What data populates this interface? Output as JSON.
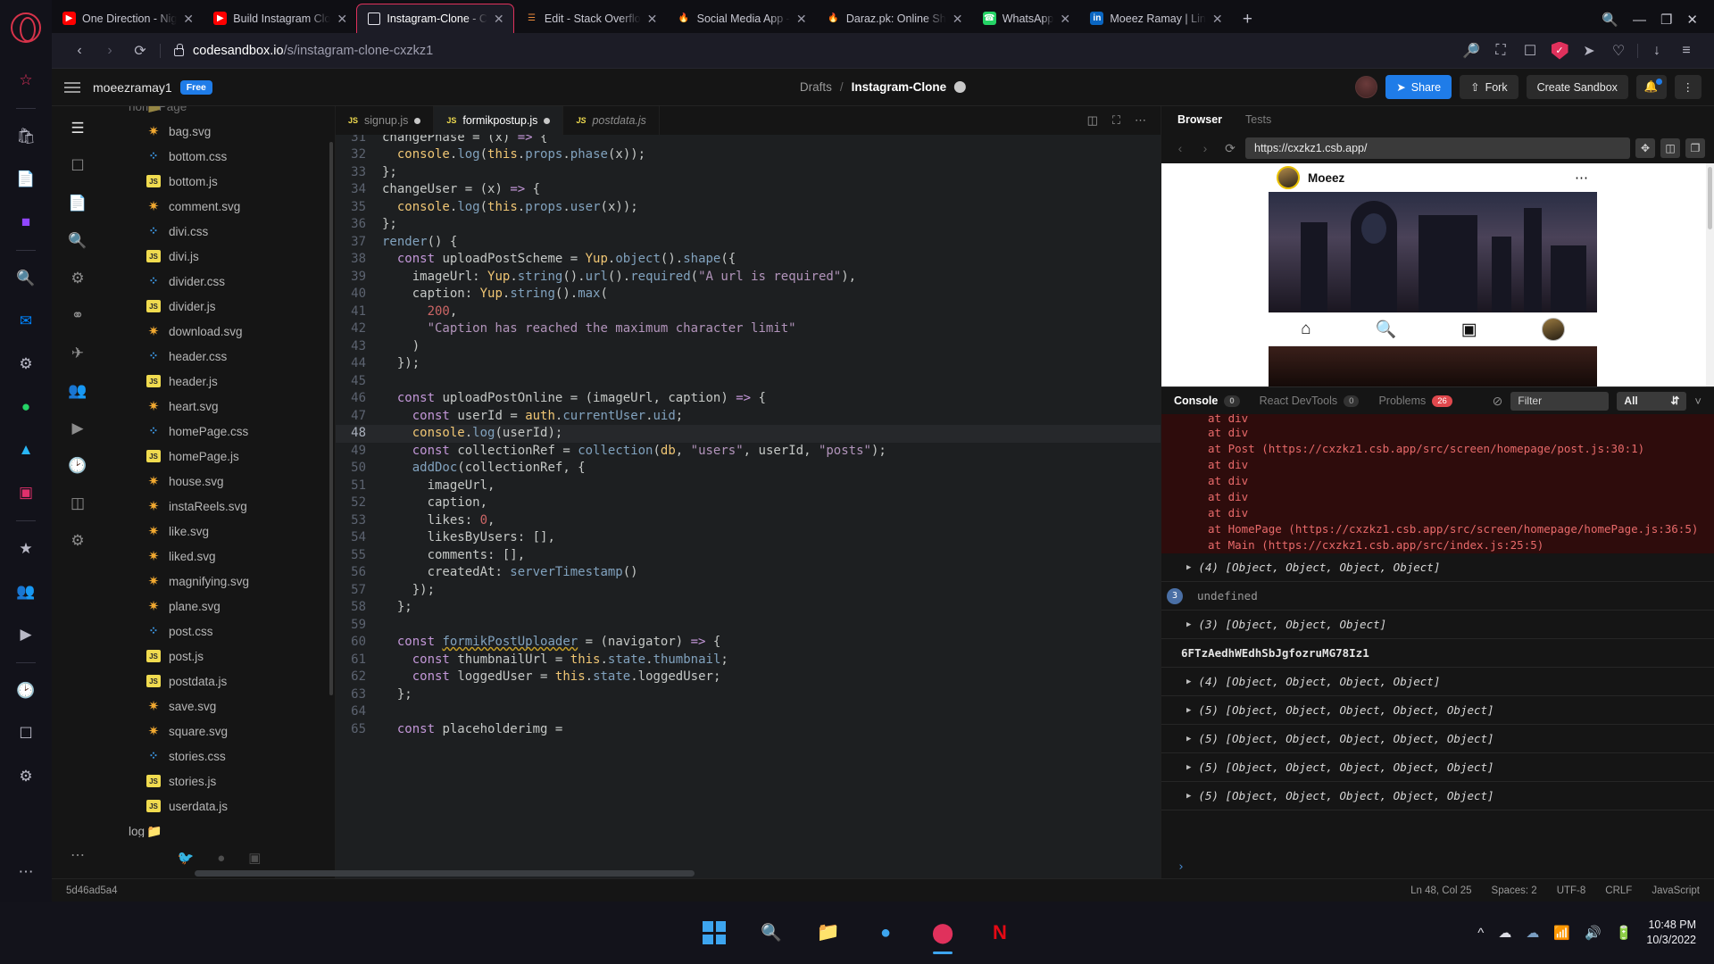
{
  "browser": {
    "sidebar_icons": [
      "opera-logo",
      "gamepad-icon",
      "extension-icon",
      "file-icon",
      "twitch-icon",
      "minus-icon",
      "messenger-icon",
      "gear-icon",
      "whatsapp-icon",
      "instagram-icon",
      "minus-icon-2",
      "people-icon"
    ],
    "tabs": [
      {
        "title": "One Direction - Nig",
        "favicon": "youtube-icon",
        "active": false
      },
      {
        "title": "Build Instagram Clo",
        "favicon": "youtube-icon",
        "active": false
      },
      {
        "title": "Instagram-Clone - C",
        "favicon": "codesandbox-icon",
        "active": true
      },
      {
        "title": "Edit - Stack Overflo",
        "favicon": "stackoverflow-icon",
        "active": false
      },
      {
        "title": "Social Media App -",
        "favicon": "firebase-icon",
        "active": false
      },
      {
        "title": "Daraz.pk: Online Sh",
        "favicon": "daraz-icon",
        "active": false
      },
      {
        "title": "WhatsApp",
        "favicon": "whatsapp-icon",
        "active": false
      },
      {
        "title": "Moeez Ramay | Lin",
        "favicon": "linkedin-icon",
        "active": false
      }
    ],
    "new_tab_label": "+",
    "window_controls": {
      "minimize": "—",
      "maximize": "❐",
      "close": "✕"
    },
    "nav": {
      "back": "‹",
      "forward": "›",
      "reload": "⟳",
      "url_domain": "codesandbox.io",
      "url_path": "/s/instagram-clone-cxzkz1",
      "url_full": "codesandbox.io/s/instagram-clone-cxzkz1",
      "right_icons": [
        "zoom-out-icon",
        "snapshot-icon",
        "camera-icon",
        "vpn-shield-icon",
        "send-icon",
        "heart-icon",
        "download-icon",
        "sliders-icon"
      ]
    }
  },
  "csb": {
    "header": {
      "username": "moeezramay1",
      "plan_badge": "Free",
      "breadcrumb_drafts": "Drafts",
      "breadcrumb_separator": "/",
      "sandbox_name": "Instagram-Clone",
      "share_label": "Share",
      "fork_label": "Fork",
      "create_sandbox_label": "Create Sandbox",
      "notifications_icon": "bell-icon",
      "more_icon": "kebab-menu-icon"
    },
    "rail_icons": [
      "files-icon",
      "search-icon",
      "git-icon",
      "deploy-icon",
      "dependencies-icon",
      "settings-icon",
      "clock-icon",
      "box-icon",
      "gear2-icon",
      "more-icon"
    ],
    "explorer": {
      "files": [
        {
          "name": "homePage",
          "type": "folder-partial"
        },
        {
          "name": "bag.svg",
          "type": "svg"
        },
        {
          "name": "bottom.css",
          "type": "css"
        },
        {
          "name": "bottom.js",
          "type": "js"
        },
        {
          "name": "comment.svg",
          "type": "svg"
        },
        {
          "name": "divi.css",
          "type": "css"
        },
        {
          "name": "divi.js",
          "type": "js"
        },
        {
          "name": "divider.css",
          "type": "css"
        },
        {
          "name": "divider.js",
          "type": "js"
        },
        {
          "name": "download.svg",
          "type": "svg"
        },
        {
          "name": "header.css",
          "type": "css"
        },
        {
          "name": "header.js",
          "type": "js"
        },
        {
          "name": "heart.svg",
          "type": "svg"
        },
        {
          "name": "homePage.css",
          "type": "css"
        },
        {
          "name": "homePage.js",
          "type": "js"
        },
        {
          "name": "house.svg",
          "type": "svg"
        },
        {
          "name": "instaReels.svg",
          "type": "svg"
        },
        {
          "name": "like.svg",
          "type": "svg"
        },
        {
          "name": "liked.svg",
          "type": "svg"
        },
        {
          "name": "magnifying.svg",
          "type": "svg"
        },
        {
          "name": "plane.svg",
          "type": "svg"
        },
        {
          "name": "post.css",
          "type": "css"
        },
        {
          "name": "post.js",
          "type": "js"
        },
        {
          "name": "postdata.js",
          "type": "js"
        },
        {
          "name": "save.svg",
          "type": "svg"
        },
        {
          "name": "square.svg",
          "type": "svg"
        },
        {
          "name": "stories.css",
          "type": "css"
        },
        {
          "name": "stories.js",
          "type": "js"
        },
        {
          "name": "userdata.js",
          "type": "js"
        },
        {
          "name": "log",
          "type": "folder"
        }
      ],
      "footer_icons": [
        "twitter-icon",
        "github-icon",
        "instagram-icon"
      ]
    },
    "editor": {
      "tabs": [
        {
          "label": "signup.js",
          "active": false,
          "dirty": true,
          "italic": false
        },
        {
          "label": "formikpostup.js",
          "active": true,
          "dirty": true,
          "italic": false
        },
        {
          "label": "postdata.js",
          "active": false,
          "dirty": false,
          "italic": true
        }
      ],
      "tab_actions": [
        "split-editor-icon",
        "preview-icon",
        "more-icon"
      ],
      "lines": [
        {
          "n": 31,
          "text": "changePhase = (x) => {",
          "clipped": true
        },
        {
          "n": 32,
          "text": "  console.log(this.props.phase(x));"
        },
        {
          "n": 33,
          "text": "};"
        },
        {
          "n": 34,
          "text": "changeUser = (x) => {"
        },
        {
          "n": 35,
          "text": "  console.log(this.props.user(x));"
        },
        {
          "n": 36,
          "text": "};"
        },
        {
          "n": 37,
          "text": "render() {"
        },
        {
          "n": 38,
          "text": "  const uploadPostScheme = Yup.object().shape({"
        },
        {
          "n": 39,
          "text": "    imageUrl: Yup.string().url().required(\"A url is required\"),"
        },
        {
          "n": 40,
          "text": "    caption: Yup.string().max("
        },
        {
          "n": 41,
          "text": "      200,"
        },
        {
          "n": 42,
          "text": "      \"Caption has reached the maximum character limit\""
        },
        {
          "n": 43,
          "text": "    )"
        },
        {
          "n": 44,
          "text": "  });"
        },
        {
          "n": 45,
          "text": ""
        },
        {
          "n": 46,
          "text": "  const uploadPostOnline = (imageUrl, caption) => {"
        },
        {
          "n": 47,
          "text": "    const userId = auth.currentUser.uid;"
        },
        {
          "n": 48,
          "text": "    console.log(userId);",
          "highlight": true
        },
        {
          "n": 49,
          "text": "    const collectionRef = collection(db, \"users\", userId, \"posts\");"
        },
        {
          "n": 50,
          "text": "    addDoc(collectionRef, {"
        },
        {
          "n": 51,
          "text": "      imageUrl,"
        },
        {
          "n": 52,
          "text": "      caption,"
        },
        {
          "n": 53,
          "text": "      likes: 0,"
        },
        {
          "n": 54,
          "text": "      likesByUsers: [],"
        },
        {
          "n": 55,
          "text": "      comments: [],"
        },
        {
          "n": 56,
          "text": "      createdAt: serverTimestamp()"
        },
        {
          "n": 57,
          "text": "    });"
        },
        {
          "n": 58,
          "text": "  };"
        },
        {
          "n": 59,
          "text": ""
        },
        {
          "n": 60,
          "text": "  const formikPostUploader = (navigator) => {"
        },
        {
          "n": 61,
          "text": "    const thumbnailUrl = this.state.thumbnail;"
        },
        {
          "n": 62,
          "text": "    const loggedUser = this.state.loggedUser;"
        },
        {
          "n": 63,
          "text": "  };"
        },
        {
          "n": 64,
          "text": ""
        },
        {
          "n": 65,
          "text": "  const placeholderimg ="
        }
      ]
    },
    "preview": {
      "tabs": [
        {
          "label": "Browser",
          "active": true
        },
        {
          "label": "Tests",
          "active": false
        }
      ],
      "url": "https://cxzkz1.csb.app/",
      "nav_icons": [
        "back-icon",
        "forward-icon",
        "reload-icon"
      ],
      "action_icons": [
        "responsive-icon",
        "split-icon",
        "popout-icon"
      ],
      "app": {
        "username": "Moeez",
        "menu_icon": "more-dots-icon",
        "nav_icons": [
          "home-icon",
          "search-icon",
          "reels-icon",
          "profile-avatar"
        ]
      }
    },
    "console": {
      "tabs": [
        {
          "label": "Console",
          "badge": "0",
          "active": true,
          "error": false
        },
        {
          "label": "React DevTools",
          "badge": "0",
          "active": false,
          "error": false
        },
        {
          "label": "Problems",
          "badge": "26",
          "active": false,
          "error": true
        }
      ],
      "clear_icon": "clear-console-icon",
      "filter_placeholder": "Filter",
      "level_selected": "All",
      "collapse_icon": "chevron-down-icon",
      "error_stack": [
        "at div",
        "at div",
        "at Post (https://cxzkz1.csb.app/src/screen/homepage/post.js:30:1)",
        "at div",
        "at div",
        "at div",
        "at div",
        "at HomePage (https://cxzkz1.csb.app/src/screen/homepage/homePage.js:36:5)",
        "at Main (https://cxzkz1.csb.app/src/index.js:25:5)"
      ],
      "rows": [
        {
          "kind": "array",
          "text": "(4) [Object, Object, Object, Object]"
        },
        {
          "kind": "undefined",
          "text": "undefined",
          "count": "3"
        },
        {
          "kind": "array",
          "text": "(3) [Object, Object, Object]"
        },
        {
          "kind": "string",
          "text": "6FTzAedhWEdhSbJgfozruMG78Iz1"
        },
        {
          "kind": "array",
          "text": "(4) [Object, Object, Object, Object]"
        },
        {
          "kind": "array",
          "text": "(5) [Object, Object, Object, Object, Object]"
        },
        {
          "kind": "array",
          "text": "(5) [Object, Object, Object, Object, Object]"
        },
        {
          "kind": "array",
          "text": "(5) [Object, Object, Object, Object, Object]"
        },
        {
          "kind": "array",
          "text": "(5) [Object, Object, Object, Object, Object]"
        }
      ],
      "prompt": "›"
    },
    "statusbar": {
      "commit": "5d46ad5a4",
      "cursor": "Ln 48, Col 25",
      "spaces": "Spaces: 2",
      "encoding": "UTF-8",
      "eol": "CRLF",
      "language": "JavaScript"
    }
  },
  "taskbar": {
    "items": [
      "windows-start-icon",
      "search-icon",
      "file-explorer-icon",
      "edge-icon",
      "opera-icon",
      "netflix-icon"
    ],
    "tray_icons": [
      "chevron-up-icon",
      "onedrive-icon",
      "cloud-icon",
      "wifi-icon",
      "volume-icon",
      "battery-icon"
    ],
    "clock_time": "10:48 PM",
    "clock_date": "10/3/2022"
  },
  "colors": {
    "accent_red": "#e0315c",
    "blue": "#1f7ce8",
    "error_bg": "#2e0c0c",
    "error_text": "#e86a6a"
  }
}
